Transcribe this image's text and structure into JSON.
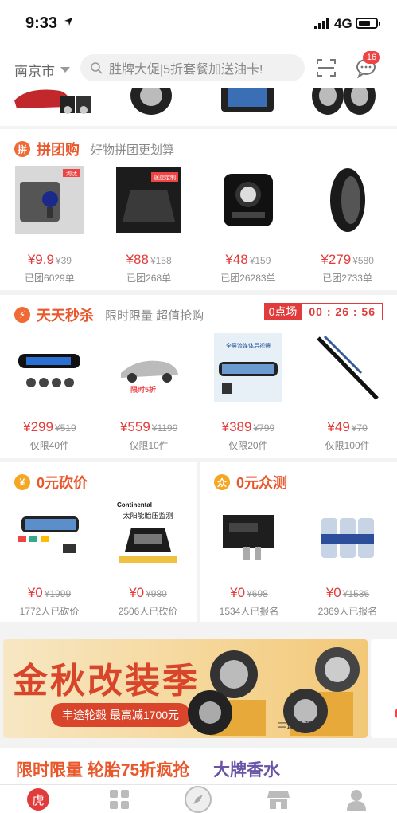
{
  "status_bar": {
    "time": "9:33",
    "network": "4G"
  },
  "header": {
    "city": "南京市",
    "search_placeholder": "胜牌大促|5折套餐加送油卡!",
    "message_count": "16"
  },
  "group_buy": {
    "title": "拼团购",
    "subtitle": "好物拼团更划算",
    "items": [
      {
        "price": "¥9.9",
        "original": "¥39",
        "meta": "已团6029单",
        "tag": "淘汰"
      },
      {
        "price": "¥88",
        "original": "¥158",
        "meta": "已团268单",
        "tag": "途虎定制"
      },
      {
        "price": "¥48",
        "original": "¥159",
        "meta": "已团26283单"
      },
      {
        "price": "¥279",
        "original": "¥580",
        "meta": "已团2733单"
      }
    ]
  },
  "flash_sale": {
    "title": "天天秒杀",
    "subtitle": "限时限量 超值抢购",
    "session_label": "0点场",
    "countdown": "00 : 26 : 56",
    "items": [
      {
        "price": "¥299",
        "original": "¥519",
        "meta": "仅限40件"
      },
      {
        "price": "¥559",
        "original": "¥1199",
        "meta": "仅限10件",
        "tag": "限时5折"
      },
      {
        "price": "¥389",
        "original": "¥799",
        "meta": "仅限20件",
        "tag": "全屏流媒体后视镜"
      },
      {
        "price": "¥49",
        "original": "¥70",
        "meta": "仅限100件"
      }
    ]
  },
  "bargain": {
    "title": "0元砍价",
    "items": [
      {
        "price": "¥0",
        "original": "¥1999",
        "meta": "1772人已砍价"
      },
      {
        "price": "¥0",
        "original": "¥980",
        "meta": "2506人已砍价",
        "tag": "太阳能胎压监测",
        "brand": "Continental"
      }
    ]
  },
  "crowd_test": {
    "title": "0元众测",
    "items": [
      {
        "price": "¥0",
        "original": "¥698",
        "meta": "1534人已报名"
      },
      {
        "price": "¥0",
        "original": "¥1536",
        "meta": "2369人已报名"
      }
    ]
  },
  "banner": {
    "headline": "金秋改装季",
    "pill": "丰途轮毂 最高减1700元",
    "brand": "丰途轮毂"
  },
  "promo": {
    "left": "限时限量 轮胎75折疯抢",
    "right": "大牌香水"
  },
  "tabbar": {
    "home_label": "虎"
  },
  "colors": {
    "accent": "#e9582c",
    "price": "#e43a3a",
    "purple": "#6a54a6"
  }
}
